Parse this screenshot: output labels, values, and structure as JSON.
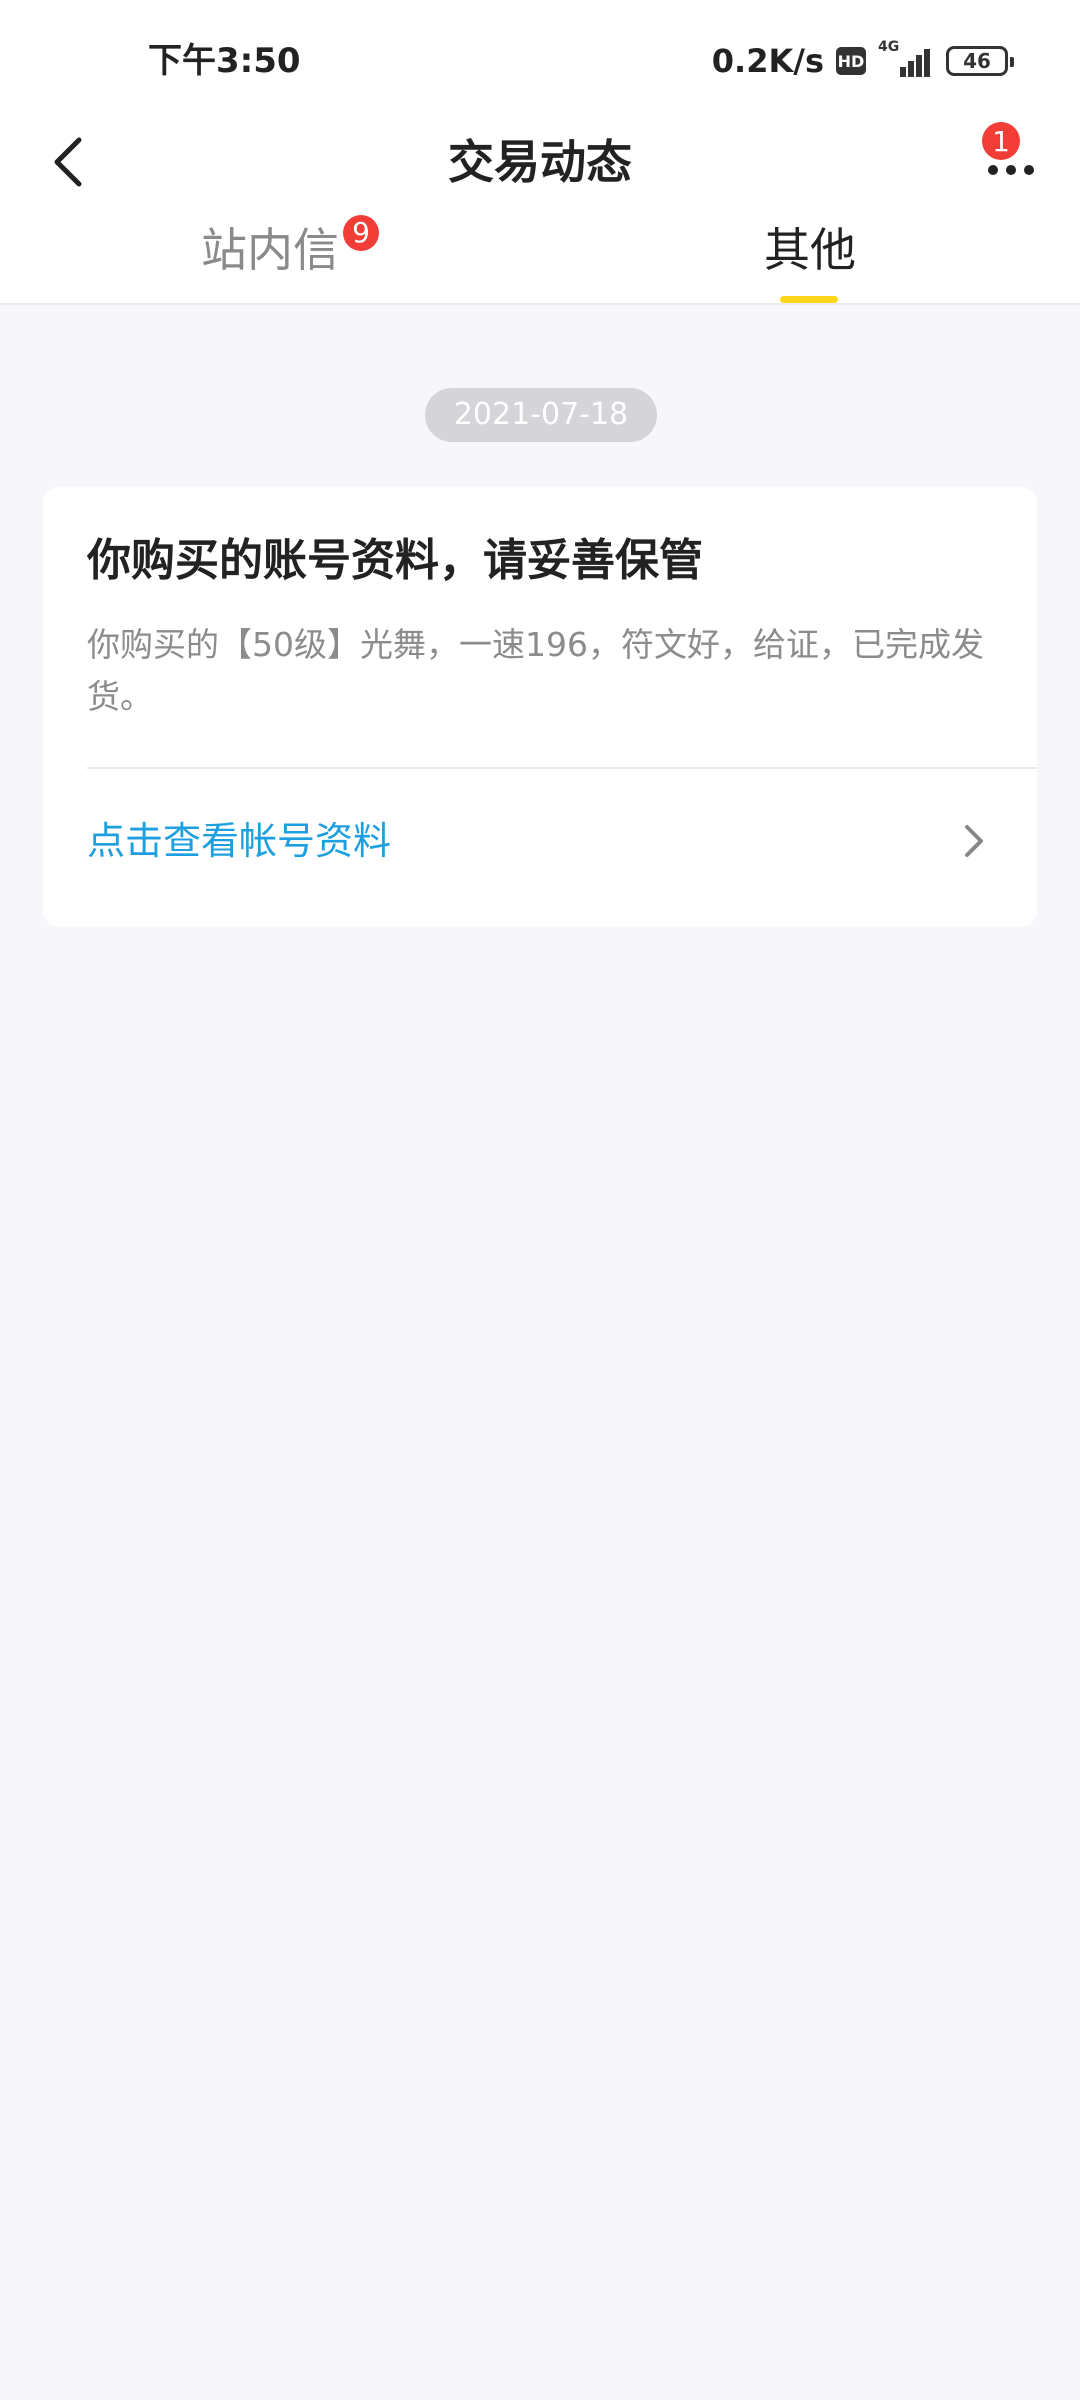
{
  "status_bar": {
    "time": "下午3:50",
    "net_speed": "0.2K/s",
    "hd_label": "HD",
    "network_label": "4G",
    "battery": "46"
  },
  "header": {
    "title": "交易动态",
    "more_badge": "1"
  },
  "tabs": [
    {
      "label": "站内信",
      "badge": "9",
      "active": false
    },
    {
      "label": "其他",
      "badge": "",
      "active": true
    }
  ],
  "feed": {
    "date": "2021-07-18",
    "card": {
      "title": "你购买的账号资料，请妥善保管",
      "description": "你购买的【50级】光舞，一速196，符文好，给证，已完成发货。",
      "link_label": "点击查看帐号资料"
    }
  },
  "colors": {
    "accent_yellow": "#ffd61a",
    "badge_red": "#f13d36",
    "link_blue": "#1d9fe0",
    "background": "#f6f6fb"
  },
  "icons": {
    "back": "chevron-left-icon",
    "more": "more-dots-icon",
    "link_arrow": "chevron-right-icon"
  }
}
